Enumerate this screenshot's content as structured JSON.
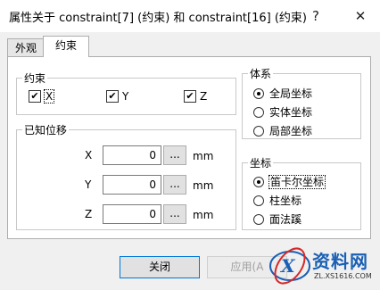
{
  "window": {
    "title": "属性关于 constraint[7] (约束) 和 constraint[16] (约束)",
    "help_label": "?",
    "close_label": "✕"
  },
  "tabs": [
    {
      "label": "外观",
      "active": false
    },
    {
      "label": "约束",
      "active": true
    }
  ],
  "constraint_group": {
    "title": "约束",
    "items": [
      {
        "label": "X",
        "checked": true
      },
      {
        "label": "Y",
        "checked": true
      },
      {
        "label": "Z",
        "checked": true
      }
    ]
  },
  "displacement_group": {
    "title": "已知位移",
    "rows": [
      {
        "axis": "X",
        "value": "0",
        "browse": "...",
        "unit": "mm"
      },
      {
        "axis": "Y",
        "value": "0",
        "browse": "...",
        "unit": "mm"
      },
      {
        "axis": "Z",
        "value": "0",
        "browse": "...",
        "unit": "mm"
      }
    ]
  },
  "system_group": {
    "title": "体系",
    "options": [
      {
        "label": "全局坐标",
        "selected": true
      },
      {
        "label": "实体坐标",
        "selected": false
      },
      {
        "label": "局部坐标",
        "selected": false
      }
    ]
  },
  "coord_group": {
    "title": "坐标",
    "options": [
      {
        "label": "笛卡尔坐标",
        "selected": true
      },
      {
        "label": "柱坐标",
        "selected": false
      },
      {
        "label": "面法蹊",
        "selected": false
      }
    ]
  },
  "buttons": {
    "close_label": "关闭",
    "apply_label": "应用(A"
  },
  "watermark": {
    "name": "资料网",
    "url": "ZL.XS1616.COM"
  },
  "colors": {
    "dialog_bg": "#f0f0f0",
    "panel_bg": "#ffffff",
    "accent": "#0078d7",
    "watermark_blue": "#1a5fb4",
    "watermark_red": "#d62828"
  }
}
